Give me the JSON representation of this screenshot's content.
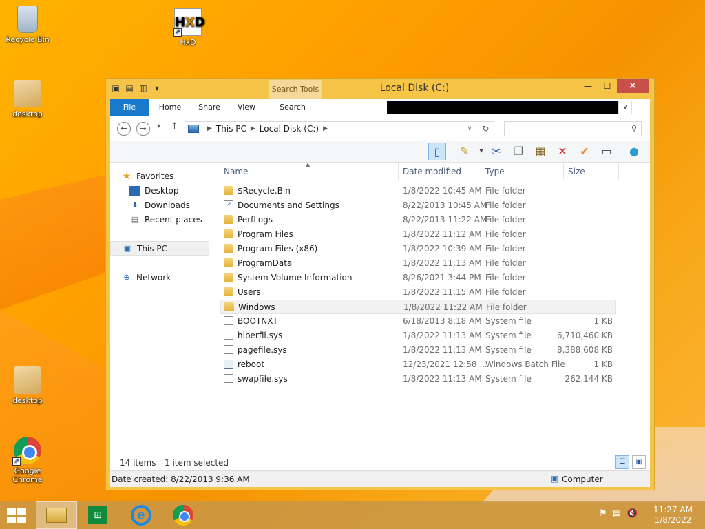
{
  "desktop": {
    "icons": [
      {
        "label": "Recycle Bin"
      },
      {
        "label": "HxD"
      },
      {
        "label": "desktop"
      },
      {
        "label": "desktop"
      },
      {
        "label": "Google Chrome"
      }
    ]
  },
  "window": {
    "title": "Local Disk (C:)",
    "context_tab": "Search Tools",
    "ribbon_tabs": [
      "File",
      "Home",
      "Share",
      "View",
      "Search"
    ],
    "address": {
      "crumbs": [
        "This PC",
        "Local Disk (C:)"
      ]
    },
    "search": {
      "value": "",
      "placeholder": ""
    },
    "nav": {
      "favorites": "Favorites",
      "desktop": "Desktop",
      "downloads": "Downloads",
      "recent": "Recent places",
      "thispc": "This PC",
      "network": "Network"
    },
    "columns": {
      "name": "Name",
      "date": "Date modified",
      "type": "Type",
      "size": "Size"
    },
    "files": [
      {
        "name": "$Recycle.Bin",
        "date": "1/8/2022 10:45 AM",
        "type": "File folder",
        "size": "",
        "icon": "folder-icon"
      },
      {
        "name": "Documents and Settings",
        "date": "8/22/2013 10:45 AM",
        "type": "File folder",
        "size": "",
        "icon": "shortcut-icon"
      },
      {
        "name": "PerfLogs",
        "date": "8/22/2013 11:22 AM",
        "type": "File folder",
        "size": "",
        "icon": "folder-icon"
      },
      {
        "name": "Program Files",
        "date": "1/8/2022 11:12 AM",
        "type": "File folder",
        "size": "",
        "icon": "folder-icon"
      },
      {
        "name": "Program Files (x86)",
        "date": "1/8/2022 10:39 AM",
        "type": "File folder",
        "size": "",
        "icon": "folder-icon"
      },
      {
        "name": "ProgramData",
        "date": "1/8/2022 11:13 AM",
        "type": "File folder",
        "size": "",
        "icon": "folder-icon"
      },
      {
        "name": "System Volume Information",
        "date": "8/26/2021 3:44 PM",
        "type": "File folder",
        "size": "",
        "icon": "folder-icon"
      },
      {
        "name": "Users",
        "date": "1/8/2022 11:15 AM",
        "type": "File folder",
        "size": "",
        "icon": "folder-icon"
      },
      {
        "name": "Windows",
        "date": "1/8/2022 11:22 AM",
        "type": "File folder",
        "size": "",
        "icon": "folder-icon"
      },
      {
        "name": "BOOTNXT",
        "date": "6/18/2013 8:18 AM",
        "type": "System file",
        "size": "1 KB",
        "icon": "file-icon"
      },
      {
        "name": "hiberfil.sys",
        "date": "1/8/2022 11:13 AM",
        "type": "System file",
        "size": "6,710,460 KB",
        "icon": "file-icon"
      },
      {
        "name": "pagefile.sys",
        "date": "1/8/2022 11:13 AM",
        "type": "System file",
        "size": "8,388,608 KB",
        "icon": "file-icon"
      },
      {
        "name": "reboot",
        "date": "12/23/2021 12:58 ...",
        "type": "Windows Batch File",
        "size": "1 KB",
        "icon": "batch-file-icon"
      },
      {
        "name": "swapfile.sys",
        "date": "1/8/2022 11:13 AM",
        "type": "System file",
        "size": "262,144 KB",
        "icon": "file-icon"
      }
    ],
    "status": {
      "count": "14 items",
      "selected": "1 item selected"
    },
    "details": {
      "created": "Date created: 8/22/2013 9:36 AM",
      "location": "Computer"
    }
  },
  "taskbar": {
    "time": "11:27 AM",
    "date": "1/8/2022"
  }
}
